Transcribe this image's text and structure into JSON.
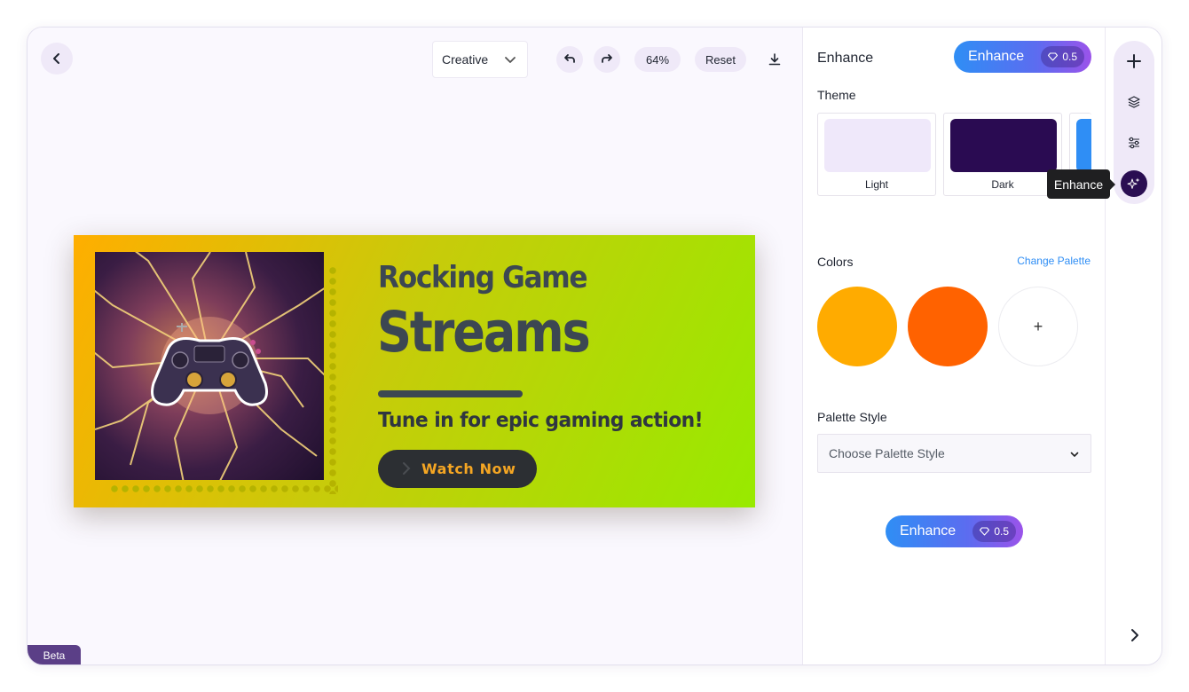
{
  "toolbar": {
    "mode_value": "Creative",
    "zoom": "64%",
    "reset_label": "Reset",
    "icons": [
      "back-arrow-icon",
      "chevron-down-icon",
      "undo-icon",
      "redo-icon",
      "download-icon"
    ]
  },
  "canvas": {
    "beta_label": "Beta",
    "banner": {
      "heading_line1": "Rocking Game",
      "heading_line2": "Streams",
      "subheading": "Tune in for epic gaming action!",
      "cta_label": "Watch Now",
      "image_icon": "game-controller-icon",
      "colors": {
        "gradient_start": "#ffae00",
        "gradient_end": "#98ea00",
        "text": "#3c4752",
        "cta_bg": "#2c2f33",
        "cta_text": "#f5a623"
      }
    }
  },
  "panel": {
    "title": "Enhance",
    "enhance_label": "Enhance",
    "enhance_cost": "0.5",
    "theme_label": "Theme",
    "themes": [
      {
        "label": "Light",
        "color": "#efe8fa"
      },
      {
        "label": "Dark",
        "color": "#2a0b52"
      },
      {
        "label": "",
        "color": "#2f8ef5"
      }
    ],
    "colors_label": "Colors",
    "change_palette_label": "Change Palette",
    "palette_colors": [
      "#ffab00",
      "#ff6200"
    ],
    "add_color_symbol": "+",
    "palette_style_label": "Palette Style",
    "palette_style_placeholder": "Choose Palette Style",
    "bottom_enhance_label": "Enhance",
    "bottom_enhance_cost": "0.5"
  },
  "rail": {
    "icons": [
      "plus-icon",
      "layers-icon",
      "sliders-icon",
      "sparkles-icon",
      "chevron-right-icon"
    ],
    "tooltip": "Enhance",
    "active_color": "#2a0e52"
  }
}
